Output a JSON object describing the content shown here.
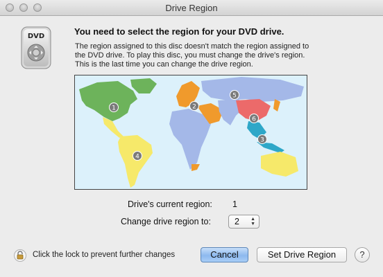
{
  "window": {
    "title": "Drive Region"
  },
  "heading": "You need to select the region for your DVD drive.",
  "description": [
    "The region assigned to this disc doesn't match the region assigned to",
    "the DVD drive. To play this disc, you must change the drive's region.",
    "This is the last time you can change the drive region."
  ],
  "dvd_icon": {
    "label": "DVD"
  },
  "map": {
    "regions": [
      {
        "number": "1",
        "color": "#6db35b"
      },
      {
        "number": "2",
        "color": "#f09a2c"
      },
      {
        "number": "3",
        "color": "#2ea7c8"
      },
      {
        "number": "4",
        "color": "#f6e96a"
      },
      {
        "number": "5",
        "color": "#a4b8e8"
      },
      {
        "number": "6",
        "color": "#ec6a6a"
      }
    ]
  },
  "current_region": {
    "label": "Drive's current region:",
    "value": "1"
  },
  "change_region": {
    "label": "Change drive region to:",
    "selected": "2"
  },
  "footer": {
    "lock_text": "Click the lock to prevent further changes",
    "cancel_label": "Cancel",
    "set_label": "Set Drive Region",
    "help_label": "?"
  }
}
